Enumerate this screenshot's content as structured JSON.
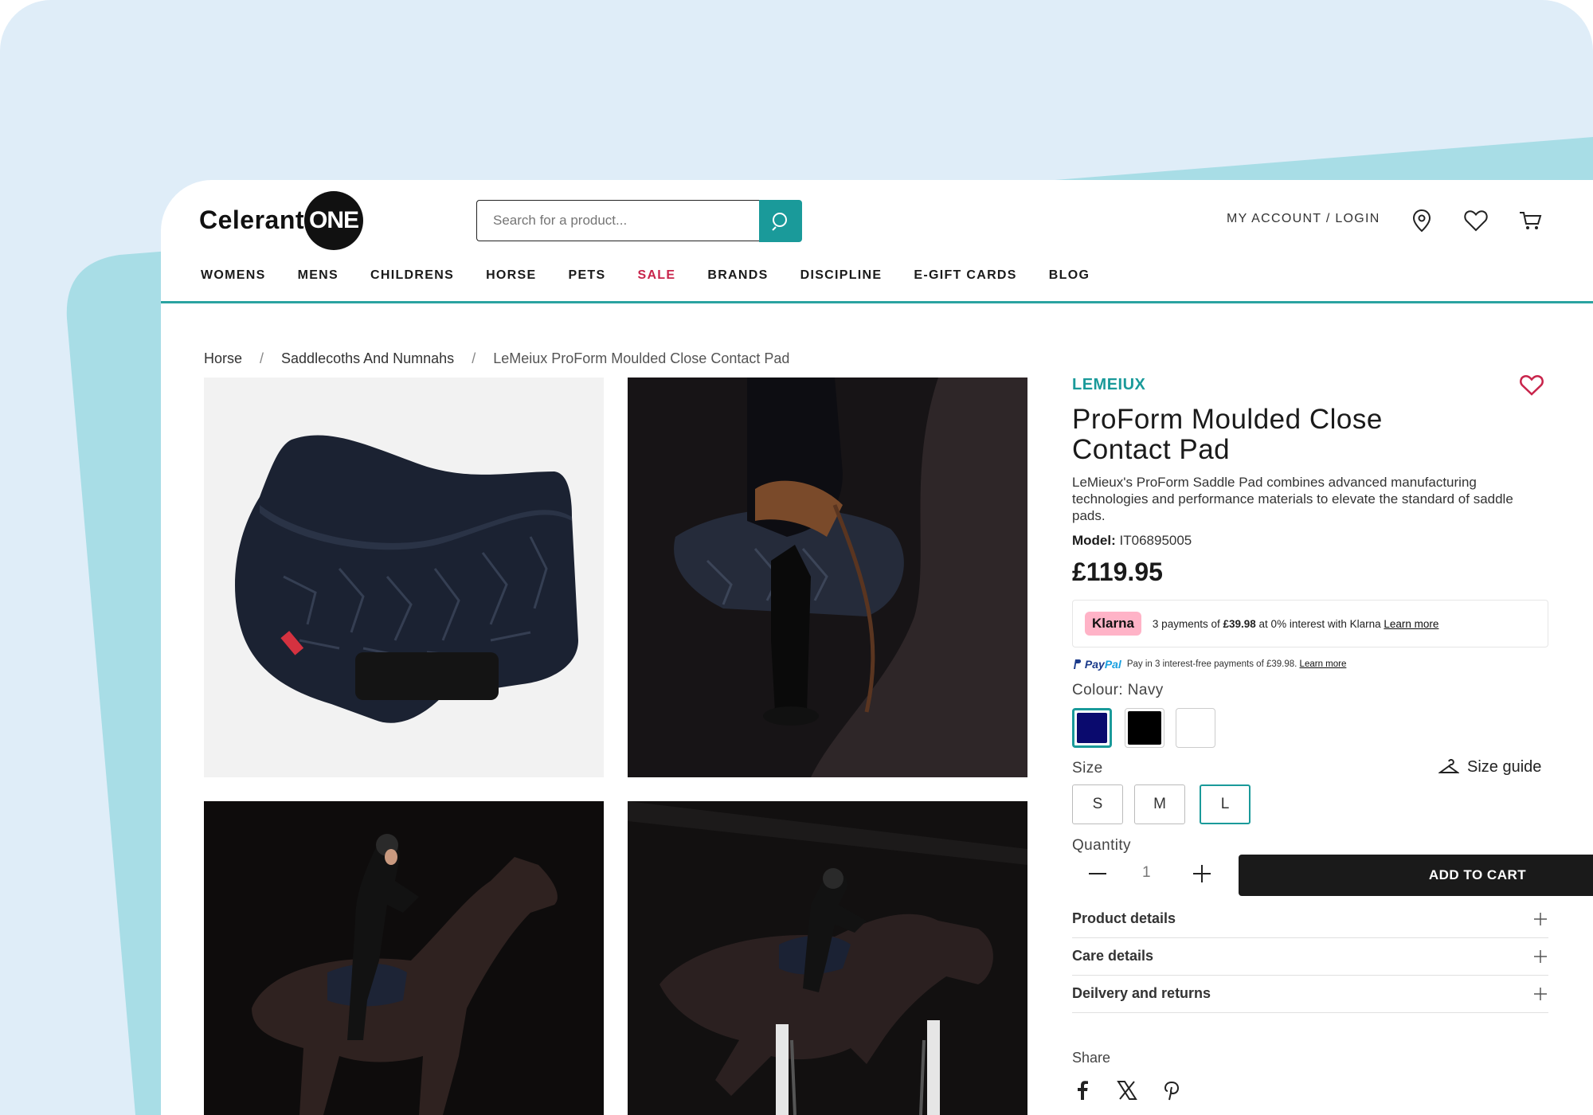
{
  "header": {
    "logo_text": "Celerant",
    "logo_badge": "ONE",
    "search_placeholder": "Search for a product...",
    "account_label": "MY ACCOUNT / LOGIN"
  },
  "nav": {
    "items": [
      "WOMENS",
      "MENS",
      "CHILDRENS",
      "HORSE",
      "PETS",
      "SALE",
      "BRANDS",
      "DISCIPLINE",
      "E-GIFT CARDS",
      "BLOG"
    ]
  },
  "breadcrumb": {
    "items": [
      "Horse",
      "Saddlecoths And Numnahs",
      "LeMeiux ProForm Moulded Close Contact Pad"
    ],
    "separator": "/"
  },
  "product": {
    "brand": "LEMEIUX",
    "title": "ProForm Moulded Close Contact Pad",
    "description": "LeMieux's ProForm Saddle Pad combines advanced manufacturing technologies and performance materials to elevate the standard of saddle pads.",
    "model_label": "Model:",
    "model_value": "IT06895005",
    "price": "£119.95"
  },
  "klarna": {
    "badge": "Klarna",
    "text_before": "3 payments of",
    "amount": "£39.98",
    "text_after": "at 0% interest with Klarna",
    "link": "Learn more"
  },
  "paypal": {
    "logo_a": "Pay",
    "logo_b": "Pal",
    "text": "Pay in 3 interest-free payments of £39.98.",
    "link": "Learn more"
  },
  "colour": {
    "label": "Colour: Navy",
    "swatches": [
      {
        "name": "Navy",
        "hex": "#0a0a6e",
        "selected": true
      },
      {
        "name": "Black",
        "hex": "#000000",
        "selected": false
      },
      {
        "name": "White",
        "hex": "#ffffff",
        "selected": false
      }
    ]
  },
  "size": {
    "label": "Size",
    "guide_label": "Size guide",
    "options": [
      "S",
      "M",
      "L"
    ],
    "selected": "L"
  },
  "quantity": {
    "label": "Quantity",
    "value": "1"
  },
  "cart": {
    "button_label": "ADD TO CART"
  },
  "accordion": [
    "Product details",
    "Care details",
    "Deilvery and returns"
  ],
  "share": {
    "label": "Share",
    "networks": [
      "facebook-icon",
      "x-icon",
      "pinterest-icon"
    ]
  },
  "colors": {
    "accent": "#1a9a9a",
    "sale": "#c8244b",
    "background": "#dfedf8",
    "teal_shape": "#a8dde6"
  }
}
